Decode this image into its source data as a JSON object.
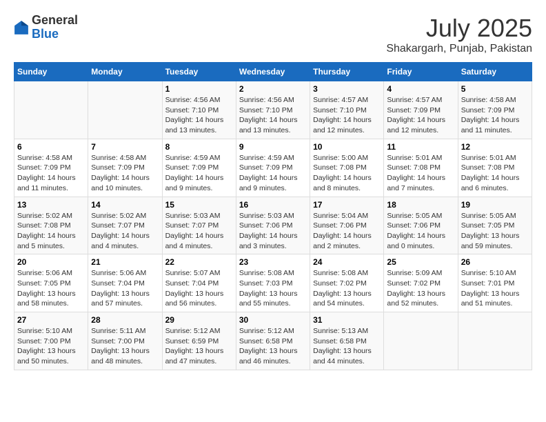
{
  "header": {
    "logo_general": "General",
    "logo_blue": "Blue",
    "main_title": "July 2025",
    "subtitle": "Shakargarh, Punjab, Pakistan"
  },
  "calendar": {
    "days_of_week": [
      "Sunday",
      "Monday",
      "Tuesday",
      "Wednesday",
      "Thursday",
      "Friday",
      "Saturday"
    ],
    "weeks": [
      [
        {
          "day": "",
          "info": ""
        },
        {
          "day": "",
          "info": ""
        },
        {
          "day": "1",
          "info": "Sunrise: 4:56 AM\nSunset: 7:10 PM\nDaylight: 14 hours and 13 minutes."
        },
        {
          "day": "2",
          "info": "Sunrise: 4:56 AM\nSunset: 7:10 PM\nDaylight: 14 hours and 13 minutes."
        },
        {
          "day": "3",
          "info": "Sunrise: 4:57 AM\nSunset: 7:10 PM\nDaylight: 14 hours and 12 minutes."
        },
        {
          "day": "4",
          "info": "Sunrise: 4:57 AM\nSunset: 7:09 PM\nDaylight: 14 hours and 12 minutes."
        },
        {
          "day": "5",
          "info": "Sunrise: 4:58 AM\nSunset: 7:09 PM\nDaylight: 14 hours and 11 minutes."
        }
      ],
      [
        {
          "day": "6",
          "info": "Sunrise: 4:58 AM\nSunset: 7:09 PM\nDaylight: 14 hours and 11 minutes."
        },
        {
          "day": "7",
          "info": "Sunrise: 4:58 AM\nSunset: 7:09 PM\nDaylight: 14 hours and 10 minutes."
        },
        {
          "day": "8",
          "info": "Sunrise: 4:59 AM\nSunset: 7:09 PM\nDaylight: 14 hours and 9 minutes."
        },
        {
          "day": "9",
          "info": "Sunrise: 4:59 AM\nSunset: 7:09 PM\nDaylight: 14 hours and 9 minutes."
        },
        {
          "day": "10",
          "info": "Sunrise: 5:00 AM\nSunset: 7:08 PM\nDaylight: 14 hours and 8 minutes."
        },
        {
          "day": "11",
          "info": "Sunrise: 5:01 AM\nSunset: 7:08 PM\nDaylight: 14 hours and 7 minutes."
        },
        {
          "day": "12",
          "info": "Sunrise: 5:01 AM\nSunset: 7:08 PM\nDaylight: 14 hours and 6 minutes."
        }
      ],
      [
        {
          "day": "13",
          "info": "Sunrise: 5:02 AM\nSunset: 7:08 PM\nDaylight: 14 hours and 5 minutes."
        },
        {
          "day": "14",
          "info": "Sunrise: 5:02 AM\nSunset: 7:07 PM\nDaylight: 14 hours and 4 minutes."
        },
        {
          "day": "15",
          "info": "Sunrise: 5:03 AM\nSunset: 7:07 PM\nDaylight: 14 hours and 4 minutes."
        },
        {
          "day": "16",
          "info": "Sunrise: 5:03 AM\nSunset: 7:06 PM\nDaylight: 14 hours and 3 minutes."
        },
        {
          "day": "17",
          "info": "Sunrise: 5:04 AM\nSunset: 7:06 PM\nDaylight: 14 hours and 2 minutes."
        },
        {
          "day": "18",
          "info": "Sunrise: 5:05 AM\nSunset: 7:06 PM\nDaylight: 14 hours and 0 minutes."
        },
        {
          "day": "19",
          "info": "Sunrise: 5:05 AM\nSunset: 7:05 PM\nDaylight: 13 hours and 59 minutes."
        }
      ],
      [
        {
          "day": "20",
          "info": "Sunrise: 5:06 AM\nSunset: 7:05 PM\nDaylight: 13 hours and 58 minutes."
        },
        {
          "day": "21",
          "info": "Sunrise: 5:06 AM\nSunset: 7:04 PM\nDaylight: 13 hours and 57 minutes."
        },
        {
          "day": "22",
          "info": "Sunrise: 5:07 AM\nSunset: 7:04 PM\nDaylight: 13 hours and 56 minutes."
        },
        {
          "day": "23",
          "info": "Sunrise: 5:08 AM\nSunset: 7:03 PM\nDaylight: 13 hours and 55 minutes."
        },
        {
          "day": "24",
          "info": "Sunrise: 5:08 AM\nSunset: 7:02 PM\nDaylight: 13 hours and 54 minutes."
        },
        {
          "day": "25",
          "info": "Sunrise: 5:09 AM\nSunset: 7:02 PM\nDaylight: 13 hours and 52 minutes."
        },
        {
          "day": "26",
          "info": "Sunrise: 5:10 AM\nSunset: 7:01 PM\nDaylight: 13 hours and 51 minutes."
        }
      ],
      [
        {
          "day": "27",
          "info": "Sunrise: 5:10 AM\nSunset: 7:00 PM\nDaylight: 13 hours and 50 minutes."
        },
        {
          "day": "28",
          "info": "Sunrise: 5:11 AM\nSunset: 7:00 PM\nDaylight: 13 hours and 48 minutes."
        },
        {
          "day": "29",
          "info": "Sunrise: 5:12 AM\nSunset: 6:59 PM\nDaylight: 13 hours and 47 minutes."
        },
        {
          "day": "30",
          "info": "Sunrise: 5:12 AM\nSunset: 6:58 PM\nDaylight: 13 hours and 46 minutes."
        },
        {
          "day": "31",
          "info": "Sunrise: 5:13 AM\nSunset: 6:58 PM\nDaylight: 13 hours and 44 minutes."
        },
        {
          "day": "",
          "info": ""
        },
        {
          "day": "",
          "info": ""
        }
      ]
    ]
  }
}
